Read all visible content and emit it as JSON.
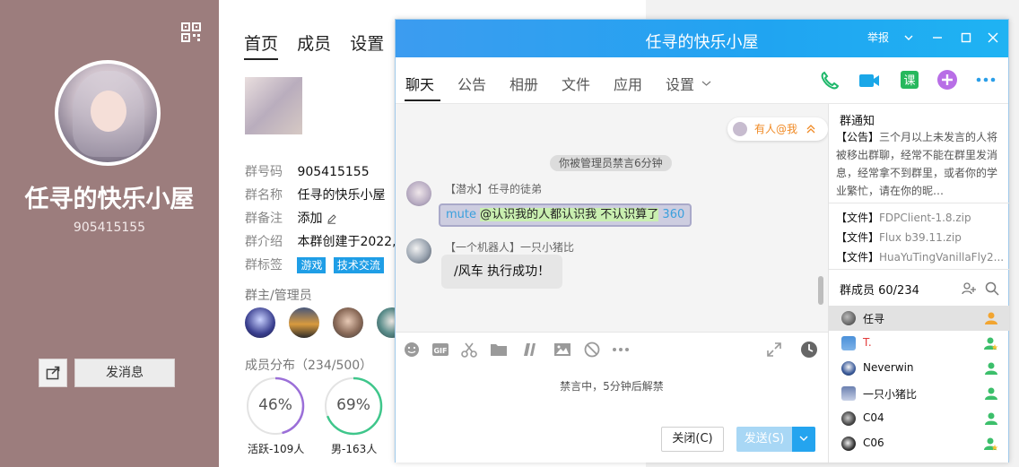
{
  "profile": {
    "group_name": "任寻的快乐小屋",
    "group_id": "905415155",
    "tabs": [
      "首页",
      "成员",
      "设置"
    ],
    "send_message_label": "发消息",
    "info": [
      {
        "key": "群号码",
        "value": "905415155"
      },
      {
        "key": "群名称",
        "value": "任寻的快乐小屋"
      },
      {
        "key": "群备注",
        "value": "添加"
      },
      {
        "key": "群介绍",
        "value": "本群创建于2022,"
      },
      {
        "key": "群标签",
        "value": ""
      }
    ],
    "tags": [
      "游戏",
      "技术交流"
    ],
    "admins_label": "群主/管理员",
    "distribution_label": "成员分布（234/500）",
    "rings": [
      {
        "percent": "46%",
        "label": "活跃-109人",
        "fraction": 0.46,
        "color": "#9b6fd8"
      },
      {
        "percent": "69%",
        "label": "男-163人",
        "fraction": 0.69,
        "color": "#3fc68b"
      }
    ]
  },
  "chat": {
    "title": "任寻的快乐小屋",
    "report_label": "举报",
    "tabs": [
      "聊天",
      "公告",
      "相册",
      "文件",
      "应用",
      "设置"
    ],
    "mention_label": "有人@我",
    "notice_pill": "你被管理员禁言6分钟",
    "messages": [
      {
        "sender": "【潜水】任寻的徒弟",
        "mute_word": "mute",
        "text": "@认识我的人都认识我 不认识算了",
        "number": "360"
      },
      {
        "sender": "【一个机器人】一只小猪比",
        "text": "/风车 执行成功！"
      }
    ],
    "mute_tip": "禁言中，5分钟后解禁",
    "close_label": "关闭(C)",
    "send_label": "发送(S)"
  },
  "side_panel": {
    "notice_title": "群通知",
    "notice_prefix": "【公告】",
    "notice_text": "三个月以上未发言的人将被移出群聊，经常不能在群里发消息，经常拿不到群里，或者你的学业繁忙，请在你的昵…",
    "files": [
      {
        "prefix": "【文件】",
        "name": "FDPClient-1.8.zip"
      },
      {
        "prefix": "【文件】",
        "name": "Flux b39.11.zip"
      },
      {
        "prefix": "【文件】",
        "name": "HuaYuTingVanillaFly2..."
      }
    ],
    "members_title": "群成员 60/234",
    "members": [
      {
        "name": "任寻",
        "role": "owner"
      },
      {
        "name": "T.",
        "role": "admin"
      },
      {
        "name": "Neverwin",
        "role": "member"
      },
      {
        "name": "一只小猪比",
        "role": "member"
      },
      {
        "name": "C04",
        "role": "member"
      },
      {
        "name": "C06",
        "role": "admin"
      }
    ]
  },
  "colors": {
    "accent": "#20a4f1",
    "profile_side": "#9c7d7d",
    "tag_blue": "#1f9ee6",
    "mention_orange": "#f08a25"
  }
}
